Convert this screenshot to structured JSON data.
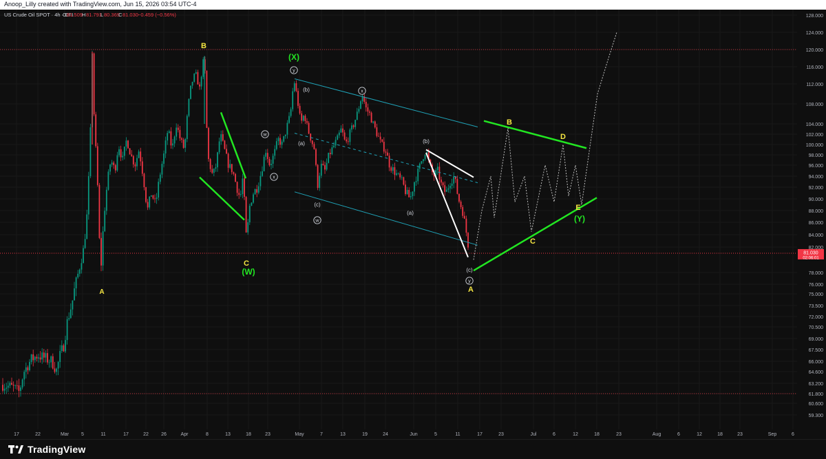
{
  "header": {
    "attribution": "Anoop_Lilly created with TradingView.com, Jun 15, 2026 03:54 UTC-4"
  },
  "footer": {
    "brand": "TradingView"
  },
  "chart_data": {
    "type": "candlestick",
    "legend_text": {
      "symbol": "US Crude Oil SPOT · 4h · CFI",
      "o_label": "O",
      "o_value": "81.509",
      "h_label": "H",
      "h_value": "81.791",
      "l_label": "L",
      "l_value": "80.369",
      "c_label": "C",
      "c_value": "81.030",
      "change": "−0.459 (−0.56%)"
    },
    "ylim": [
      58.5,
      130.5
    ],
    "y_ticks": [
      "128.000",
      "124.000",
      "120.000",
      "116.000",
      "112.000",
      "108.000",
      "104.000",
      "102.000",
      "100.000",
      "98.000",
      "96.000",
      "94.000",
      "92.000",
      "90.000",
      "88.000",
      "86.000",
      "84.000",
      "82.000",
      "78.000",
      "76.000",
      "75.000",
      "73.500",
      "72.000",
      "70.500",
      "69.000",
      "67.500",
      "66.000",
      "64.600",
      "63.200",
      "61.800",
      "60.600",
      "59.300"
    ],
    "x_ticks": [
      "17",
      "22",
      "Mar",
      "5",
      "11",
      "17",
      "22",
      "26",
      "Apr",
      "8",
      "13",
      "18",
      "23",
      "May",
      "7",
      "13",
      "19",
      "24",
      "Jun",
      "5",
      "11",
      "17",
      "23",
      "Jul",
      "6",
      "12",
      "18",
      "23",
      "Aug",
      "6",
      "12",
      "18",
      "23",
      "Sep",
      "6"
    ],
    "last_price": {
      "value": 81.03,
      "label": "81.030",
      "countdown": "02:06:01",
      "color": "#f23645"
    },
    "reference_lines": [
      {
        "value": 120.0,
        "color": "#f23645"
      },
      {
        "value": 61.8,
        "color": "#f23645"
      }
    ],
    "colors": {
      "up": "#089981",
      "down": "#f23645",
      "green_line": "#22e622",
      "white_line": "#ffffff",
      "channel": "#1fa3b8",
      "wave_yellow": "#f5e642",
      "wave_green": "#22e622"
    },
    "candles": [],
    "wave_labels": [
      {
        "text": "A",
        "color": "yellow"
      },
      {
        "text": "B",
        "color": "yellow"
      },
      {
        "text": "C",
        "color": "yellow"
      },
      {
        "text": "(W)",
        "color": "green"
      },
      {
        "text": "(X)",
        "color": "green"
      },
      {
        "text": "y",
        "color": "circle"
      },
      {
        "text": "(b)",
        "color": "white"
      },
      {
        "text": "x",
        "color": "circle"
      },
      {
        "text": "w",
        "color": "circle"
      },
      {
        "text": "(a)",
        "color": "white"
      },
      {
        "text": "x",
        "color": "circle"
      },
      {
        "text": "(c)",
        "color": "white"
      },
      {
        "text": "w",
        "color": "circle"
      },
      {
        "text": "(b)",
        "color": "white"
      },
      {
        "text": "(a)",
        "color": "white"
      },
      {
        "text": "(c)",
        "color": "white"
      },
      {
        "text": "y",
        "color": "circle"
      },
      {
        "text": "A",
        "color": "yellow"
      },
      {
        "text": "B",
        "color": "yellow"
      },
      {
        "text": "C",
        "color": "yellow"
      },
      {
        "text": "D",
        "color": "yellow"
      },
      {
        "text": "E",
        "color": "yellow"
      },
      {
        "text": "(Y)",
        "color": "green"
      }
    ]
  }
}
